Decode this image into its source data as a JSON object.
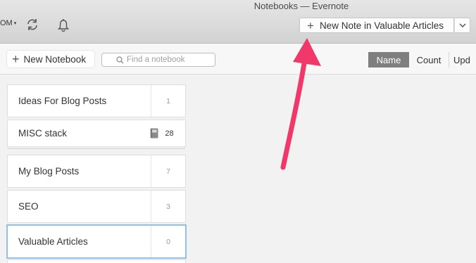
{
  "window": {
    "title": "Notebooks — Evernote"
  },
  "toolbar": {
    "account_label": "OM",
    "new_note_label": "New Note in Valuable Articles"
  },
  "actionbar": {
    "new_notebook_label": "New Notebook",
    "search_placeholder": "Find a notebook",
    "sort": {
      "name": "Name",
      "count": "Count",
      "updated": "Upd"
    }
  },
  "notebooks": [
    {
      "name": "Ideas For Blog Posts",
      "count": "1"
    },
    {
      "name": "MISC stack",
      "count": "28",
      "icon": "notebook-stack-icon"
    },
    {
      "name": "My Blog Posts",
      "count": "7"
    },
    {
      "name": "SEO",
      "count": "3"
    },
    {
      "name": "Valuable Articles",
      "count": "0"
    }
  ],
  "colors": {
    "arrow": "#f0386b",
    "selected_border": "#8cc2ec",
    "sort_active": "#7f7f7f"
  }
}
